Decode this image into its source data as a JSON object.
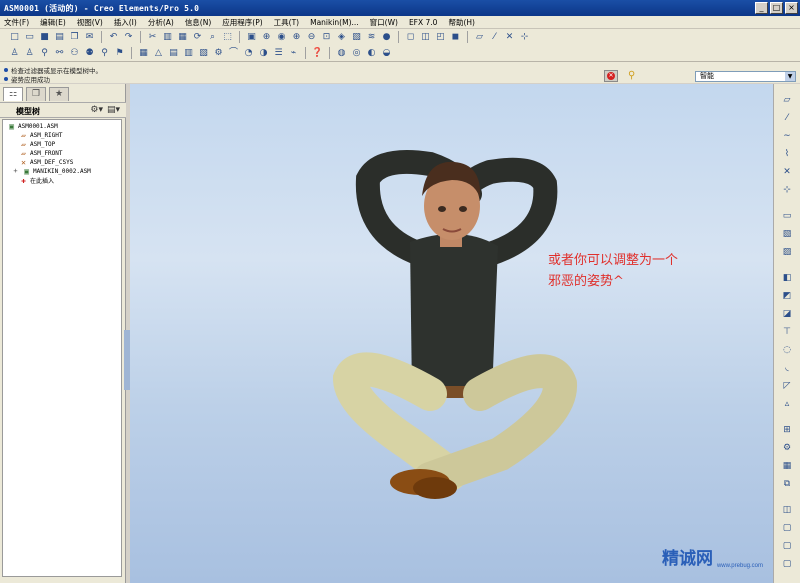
{
  "window": {
    "title": "ASM0001 (活动的) - Creo Elements/Pro 5.0",
    "controls": [
      "_",
      "□",
      "×"
    ]
  },
  "menu": [
    "文件(F)",
    "编辑(E)",
    "视图(V)",
    "插入(I)",
    "分析(A)",
    "信息(N)",
    "应用程序(P)",
    "工具(T)",
    "Manikin(M)...",
    "窗口(W)",
    "EFX 7.0",
    "帮助(H)"
  ],
  "toolbar1": [
    "new-icon",
    "open-icon",
    "save-icon",
    "print-icon",
    "copy-icon",
    "email-icon",
    "undo-icon",
    "redo-icon",
    "cut-icon",
    "paste-icon",
    "paste-special-icon",
    "regenerate-icon",
    "find-icon",
    "select-box-icon",
    "repaint-icon",
    "spin-center-icon",
    "view-icon",
    "zoom-in-icon",
    "zoom-out-icon",
    "refit-icon",
    "reorient-icon",
    "saved-views-icon",
    "layers-icon",
    "appearance-icon",
    "wireframe-icon",
    "hidden-line-icon",
    "no-hidden-icon",
    "shading-icon",
    "plane-toggle-icon",
    "axis-toggle-icon",
    "point-toggle-icon",
    "csys-toggle-icon"
  ],
  "toolbar2": [
    "manikin-1-icon",
    "manikin-2-icon",
    "manikin-3-icon",
    "manikin-4-icon",
    "manikin-5-icon",
    "manikin-6-icon",
    "manikin-7-icon",
    "manikin-8-icon",
    "posture-1-icon",
    "posture-2-icon",
    "posture-3-icon",
    "posture-4-icon",
    "posture-5-icon",
    "posture-6-icon",
    "posture-7-icon",
    "posture-8-icon",
    "posture-9-icon",
    "posture-10-icon",
    "posture-11-icon",
    "help-icon",
    "analysis-1-icon",
    "analysis-2-icon",
    "analysis-3-icon",
    "analysis-4-icon"
  ],
  "messages": [
    "检查过滤器或显示在模型树中。",
    "姿势应用成功"
  ],
  "filter": {
    "selected": "智能"
  },
  "navigator": {
    "tabs": [
      "model-tree-tab",
      "folder-browser-tab",
      "favorites-tab"
    ],
    "header": "模型树",
    "items": [
      {
        "label": "ASM0001.ASM",
        "icon": "assembly-icon",
        "depth": 0
      },
      {
        "label": "ASM_RIGHT",
        "icon": "datum-plane-icon",
        "depth": 1
      },
      {
        "label": "ASM_TOP",
        "icon": "datum-plane-icon",
        "depth": 1
      },
      {
        "label": "ASM_FRONT",
        "icon": "datum-plane-icon",
        "depth": 1
      },
      {
        "label": "ASM_DEF_CSYS",
        "icon": "csys-icon",
        "depth": 1
      },
      {
        "label": "MANIKIN_0002.ASM",
        "icon": "subassembly-icon",
        "depth": 1
      },
      {
        "label": "在此插入",
        "icon": "insert-here-icon",
        "depth": 1
      }
    ]
  },
  "viewport": {
    "annotation_line1": "或者你可以调整为一个",
    "annotation_line2": "邪恶的姿势^",
    "watermark": "精诚网",
    "watermark_sub": "www.prebug.com"
  },
  "rightbar": [
    "datum-plane-icon",
    "datum-axis-icon",
    "datum-curve-icon",
    "sketched-curve-icon",
    "datum-point-icon",
    "csys-icon",
    "assemble-icon",
    "create-component-icon",
    "package-icon",
    "extrude-icon",
    "revolve-icon",
    "sweep-icon",
    "blend-icon",
    "hole-icon",
    "round-icon",
    "chamfer-icon",
    "rib-icon",
    "draft-icon",
    "shell-icon",
    "pattern-icon",
    "mirror-icon",
    "merge-icon",
    "trim-icon",
    "offset-icon",
    "thicken-icon"
  ]
}
